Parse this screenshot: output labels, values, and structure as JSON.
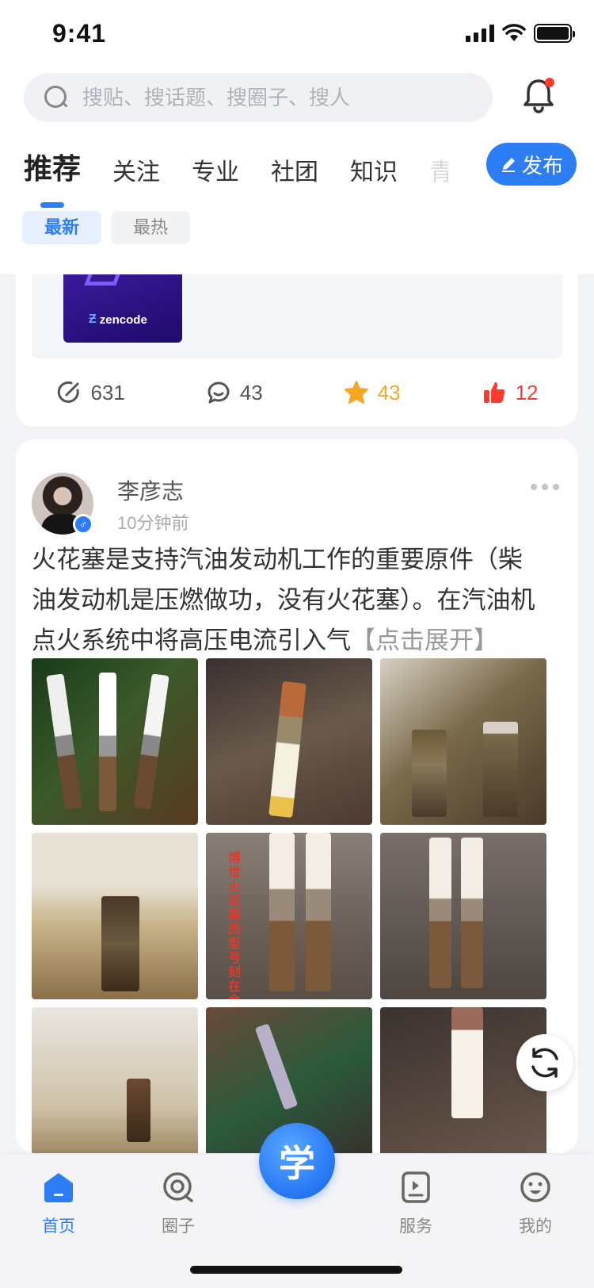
{
  "status_bar": {
    "time": "9:41"
  },
  "search": {
    "placeholder": "搜贴、搜话题、搜圈子、搜人"
  },
  "tabs": [
    {
      "label": "推荐"
    },
    {
      "label": "关注"
    },
    {
      "label": "专业"
    },
    {
      "label": "社团"
    },
    {
      "label": "知识"
    },
    {
      "label": "青"
    }
  ],
  "publish_label": "发布",
  "filters": [
    {
      "label": "最新",
      "active": true
    },
    {
      "label": "最热",
      "active": false
    }
  ],
  "card1": {
    "thumb_text": "zencode",
    "stats": {
      "views": "631",
      "comments": "43",
      "favorites": "43",
      "likes": "12"
    }
  },
  "card2": {
    "username": "李彦志",
    "time": "10分钟前",
    "text": "火花塞是支持汽油发动机工作的重要原件（柴油发动机是压燃做功，没有火花塞）。在汽油机点火系统中将高压电流引入气",
    "expand": "【点击展开】",
    "photo_caption": "博世火花塞的型号刻在金属上"
  },
  "bottom_nav": {
    "home": "首页",
    "circle": "圈子",
    "center": "学",
    "service": "服务",
    "mine": "我的"
  },
  "colors": {
    "accent": "#2c7df6",
    "star": "#f5a623",
    "like": "#ff3b30"
  }
}
